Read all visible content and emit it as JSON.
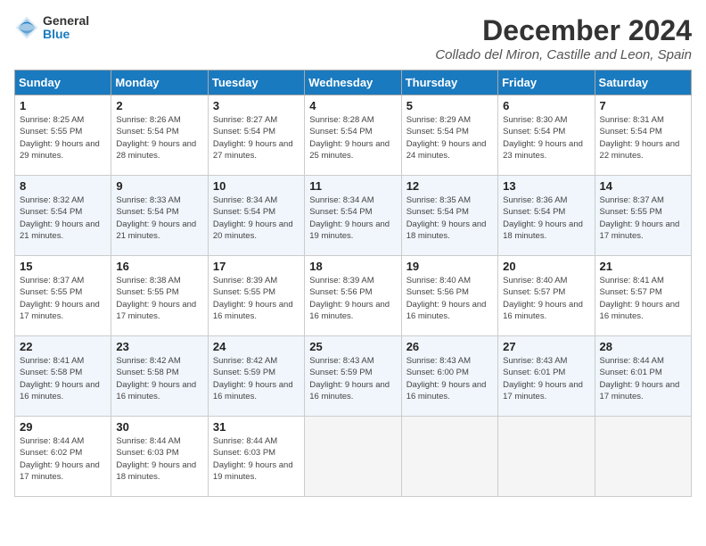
{
  "logo": {
    "general": "General",
    "blue": "Blue"
  },
  "header": {
    "month_title": "December 2024",
    "subtitle": "Collado del Miron, Castille and Leon, Spain"
  },
  "weekdays": [
    "Sunday",
    "Monday",
    "Tuesday",
    "Wednesday",
    "Thursday",
    "Friday",
    "Saturday"
  ],
  "weeks": [
    [
      {
        "day": "1",
        "sunrise": "8:25 AM",
        "sunset": "5:55 PM",
        "daylight": "9 hours and 29 minutes."
      },
      {
        "day": "2",
        "sunrise": "8:26 AM",
        "sunset": "5:54 PM",
        "daylight": "9 hours and 28 minutes."
      },
      {
        "day": "3",
        "sunrise": "8:27 AM",
        "sunset": "5:54 PM",
        "daylight": "9 hours and 27 minutes."
      },
      {
        "day": "4",
        "sunrise": "8:28 AM",
        "sunset": "5:54 PM",
        "daylight": "9 hours and 25 minutes."
      },
      {
        "day": "5",
        "sunrise": "8:29 AM",
        "sunset": "5:54 PM",
        "daylight": "9 hours and 24 minutes."
      },
      {
        "day": "6",
        "sunrise": "8:30 AM",
        "sunset": "5:54 PM",
        "daylight": "9 hours and 23 minutes."
      },
      {
        "day": "7",
        "sunrise": "8:31 AM",
        "sunset": "5:54 PM",
        "daylight": "9 hours and 22 minutes."
      }
    ],
    [
      {
        "day": "8",
        "sunrise": "8:32 AM",
        "sunset": "5:54 PM",
        "daylight": "9 hours and 21 minutes."
      },
      {
        "day": "9",
        "sunrise": "8:33 AM",
        "sunset": "5:54 PM",
        "daylight": "9 hours and 21 minutes."
      },
      {
        "day": "10",
        "sunrise": "8:34 AM",
        "sunset": "5:54 PM",
        "daylight": "9 hours and 20 minutes."
      },
      {
        "day": "11",
        "sunrise": "8:34 AM",
        "sunset": "5:54 PM",
        "daylight": "9 hours and 19 minutes."
      },
      {
        "day": "12",
        "sunrise": "8:35 AM",
        "sunset": "5:54 PM",
        "daylight": "9 hours and 18 minutes."
      },
      {
        "day": "13",
        "sunrise": "8:36 AM",
        "sunset": "5:54 PM",
        "daylight": "9 hours and 18 minutes."
      },
      {
        "day": "14",
        "sunrise": "8:37 AM",
        "sunset": "5:55 PM",
        "daylight": "9 hours and 17 minutes."
      }
    ],
    [
      {
        "day": "15",
        "sunrise": "8:37 AM",
        "sunset": "5:55 PM",
        "daylight": "9 hours and 17 minutes."
      },
      {
        "day": "16",
        "sunrise": "8:38 AM",
        "sunset": "5:55 PM",
        "daylight": "9 hours and 17 minutes."
      },
      {
        "day": "17",
        "sunrise": "8:39 AM",
        "sunset": "5:55 PM",
        "daylight": "9 hours and 16 minutes."
      },
      {
        "day": "18",
        "sunrise": "8:39 AM",
        "sunset": "5:56 PM",
        "daylight": "9 hours and 16 minutes."
      },
      {
        "day": "19",
        "sunrise": "8:40 AM",
        "sunset": "5:56 PM",
        "daylight": "9 hours and 16 minutes."
      },
      {
        "day": "20",
        "sunrise": "8:40 AM",
        "sunset": "5:57 PM",
        "daylight": "9 hours and 16 minutes."
      },
      {
        "day": "21",
        "sunrise": "8:41 AM",
        "sunset": "5:57 PM",
        "daylight": "9 hours and 16 minutes."
      }
    ],
    [
      {
        "day": "22",
        "sunrise": "8:41 AM",
        "sunset": "5:58 PM",
        "daylight": "9 hours and 16 minutes."
      },
      {
        "day": "23",
        "sunrise": "8:42 AM",
        "sunset": "5:58 PM",
        "daylight": "9 hours and 16 minutes."
      },
      {
        "day": "24",
        "sunrise": "8:42 AM",
        "sunset": "5:59 PM",
        "daylight": "9 hours and 16 minutes."
      },
      {
        "day": "25",
        "sunrise": "8:43 AM",
        "sunset": "5:59 PM",
        "daylight": "9 hours and 16 minutes."
      },
      {
        "day": "26",
        "sunrise": "8:43 AM",
        "sunset": "6:00 PM",
        "daylight": "9 hours and 16 minutes."
      },
      {
        "day": "27",
        "sunrise": "8:43 AM",
        "sunset": "6:01 PM",
        "daylight": "9 hours and 17 minutes."
      },
      {
        "day": "28",
        "sunrise": "8:44 AM",
        "sunset": "6:01 PM",
        "daylight": "9 hours and 17 minutes."
      }
    ],
    [
      {
        "day": "29",
        "sunrise": "8:44 AM",
        "sunset": "6:02 PM",
        "daylight": "9 hours and 17 minutes."
      },
      {
        "day": "30",
        "sunrise": "8:44 AM",
        "sunset": "6:03 PM",
        "daylight": "9 hours and 18 minutes."
      },
      {
        "day": "31",
        "sunrise": "8:44 AM",
        "sunset": "6:03 PM",
        "daylight": "9 hours and 19 minutes."
      },
      null,
      null,
      null,
      null
    ]
  ]
}
